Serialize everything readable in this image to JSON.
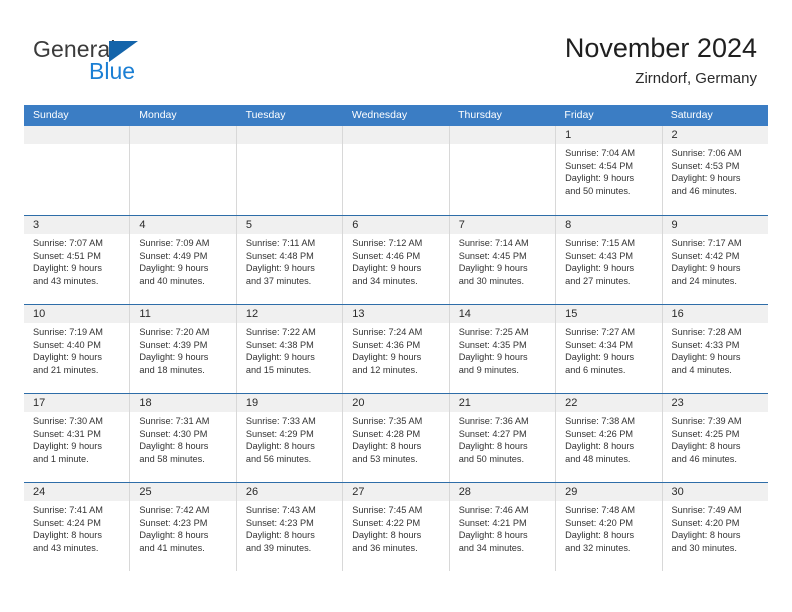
{
  "brand": {
    "line1": "General",
    "line2": "Blue",
    "triangle_color": "#1464aa",
    "line2_color": "#1b7fd4"
  },
  "header": {
    "title": "November 2024",
    "subtitle": "Zirndorf, Germany"
  },
  "theme": {
    "header_row_bg": "#3b7dc4",
    "day_number_bg": "#f0f0f0",
    "row_separator": "#2e6da8",
    "cell_border": "#d8d8d8"
  },
  "weekdays": [
    "Sunday",
    "Monday",
    "Tuesday",
    "Wednesday",
    "Thursday",
    "Friday",
    "Saturday"
  ],
  "weeks": [
    [
      {
        "day": "",
        "empty": true
      },
      {
        "day": "",
        "empty": true
      },
      {
        "day": "",
        "empty": true
      },
      {
        "day": "",
        "empty": true
      },
      {
        "day": "",
        "empty": true
      },
      {
        "day": "1",
        "sunrise": "Sunrise: 7:04 AM",
        "sunset": "Sunset: 4:54 PM",
        "daylight1": "Daylight: 9 hours",
        "daylight2": "and 50 minutes."
      },
      {
        "day": "2",
        "sunrise": "Sunrise: 7:06 AM",
        "sunset": "Sunset: 4:53 PM",
        "daylight1": "Daylight: 9 hours",
        "daylight2": "and 46 minutes."
      }
    ],
    [
      {
        "day": "3",
        "sunrise": "Sunrise: 7:07 AM",
        "sunset": "Sunset: 4:51 PM",
        "daylight1": "Daylight: 9 hours",
        "daylight2": "and 43 minutes."
      },
      {
        "day": "4",
        "sunrise": "Sunrise: 7:09 AM",
        "sunset": "Sunset: 4:49 PM",
        "daylight1": "Daylight: 9 hours",
        "daylight2": "and 40 minutes."
      },
      {
        "day": "5",
        "sunrise": "Sunrise: 7:11 AM",
        "sunset": "Sunset: 4:48 PM",
        "daylight1": "Daylight: 9 hours",
        "daylight2": "and 37 minutes."
      },
      {
        "day": "6",
        "sunrise": "Sunrise: 7:12 AM",
        "sunset": "Sunset: 4:46 PM",
        "daylight1": "Daylight: 9 hours",
        "daylight2": "and 34 minutes."
      },
      {
        "day": "7",
        "sunrise": "Sunrise: 7:14 AM",
        "sunset": "Sunset: 4:45 PM",
        "daylight1": "Daylight: 9 hours",
        "daylight2": "and 30 minutes."
      },
      {
        "day": "8",
        "sunrise": "Sunrise: 7:15 AM",
        "sunset": "Sunset: 4:43 PM",
        "daylight1": "Daylight: 9 hours",
        "daylight2": "and 27 minutes."
      },
      {
        "day": "9",
        "sunrise": "Sunrise: 7:17 AM",
        "sunset": "Sunset: 4:42 PM",
        "daylight1": "Daylight: 9 hours",
        "daylight2": "and 24 minutes."
      }
    ],
    [
      {
        "day": "10",
        "sunrise": "Sunrise: 7:19 AM",
        "sunset": "Sunset: 4:40 PM",
        "daylight1": "Daylight: 9 hours",
        "daylight2": "and 21 minutes."
      },
      {
        "day": "11",
        "sunrise": "Sunrise: 7:20 AM",
        "sunset": "Sunset: 4:39 PM",
        "daylight1": "Daylight: 9 hours",
        "daylight2": "and 18 minutes."
      },
      {
        "day": "12",
        "sunrise": "Sunrise: 7:22 AM",
        "sunset": "Sunset: 4:38 PM",
        "daylight1": "Daylight: 9 hours",
        "daylight2": "and 15 minutes."
      },
      {
        "day": "13",
        "sunrise": "Sunrise: 7:24 AM",
        "sunset": "Sunset: 4:36 PM",
        "daylight1": "Daylight: 9 hours",
        "daylight2": "and 12 minutes."
      },
      {
        "day": "14",
        "sunrise": "Sunrise: 7:25 AM",
        "sunset": "Sunset: 4:35 PM",
        "daylight1": "Daylight: 9 hours",
        "daylight2": "and 9 minutes."
      },
      {
        "day": "15",
        "sunrise": "Sunrise: 7:27 AM",
        "sunset": "Sunset: 4:34 PM",
        "daylight1": "Daylight: 9 hours",
        "daylight2": "and 6 minutes."
      },
      {
        "day": "16",
        "sunrise": "Sunrise: 7:28 AM",
        "sunset": "Sunset: 4:33 PM",
        "daylight1": "Daylight: 9 hours",
        "daylight2": "and 4 minutes."
      }
    ],
    [
      {
        "day": "17",
        "sunrise": "Sunrise: 7:30 AM",
        "sunset": "Sunset: 4:31 PM",
        "daylight1": "Daylight: 9 hours",
        "daylight2": "and 1 minute."
      },
      {
        "day": "18",
        "sunrise": "Sunrise: 7:31 AM",
        "sunset": "Sunset: 4:30 PM",
        "daylight1": "Daylight: 8 hours",
        "daylight2": "and 58 minutes."
      },
      {
        "day": "19",
        "sunrise": "Sunrise: 7:33 AM",
        "sunset": "Sunset: 4:29 PM",
        "daylight1": "Daylight: 8 hours",
        "daylight2": "and 56 minutes."
      },
      {
        "day": "20",
        "sunrise": "Sunrise: 7:35 AM",
        "sunset": "Sunset: 4:28 PM",
        "daylight1": "Daylight: 8 hours",
        "daylight2": "and 53 minutes."
      },
      {
        "day": "21",
        "sunrise": "Sunrise: 7:36 AM",
        "sunset": "Sunset: 4:27 PM",
        "daylight1": "Daylight: 8 hours",
        "daylight2": "and 50 minutes."
      },
      {
        "day": "22",
        "sunrise": "Sunrise: 7:38 AM",
        "sunset": "Sunset: 4:26 PM",
        "daylight1": "Daylight: 8 hours",
        "daylight2": "and 48 minutes."
      },
      {
        "day": "23",
        "sunrise": "Sunrise: 7:39 AM",
        "sunset": "Sunset: 4:25 PM",
        "daylight1": "Daylight: 8 hours",
        "daylight2": "and 46 minutes."
      }
    ],
    [
      {
        "day": "24",
        "sunrise": "Sunrise: 7:41 AM",
        "sunset": "Sunset: 4:24 PM",
        "daylight1": "Daylight: 8 hours",
        "daylight2": "and 43 minutes."
      },
      {
        "day": "25",
        "sunrise": "Sunrise: 7:42 AM",
        "sunset": "Sunset: 4:23 PM",
        "daylight1": "Daylight: 8 hours",
        "daylight2": "and 41 minutes."
      },
      {
        "day": "26",
        "sunrise": "Sunrise: 7:43 AM",
        "sunset": "Sunset: 4:23 PM",
        "daylight1": "Daylight: 8 hours",
        "daylight2": "and 39 minutes."
      },
      {
        "day": "27",
        "sunrise": "Sunrise: 7:45 AM",
        "sunset": "Sunset: 4:22 PM",
        "daylight1": "Daylight: 8 hours",
        "daylight2": "and 36 minutes."
      },
      {
        "day": "28",
        "sunrise": "Sunrise: 7:46 AM",
        "sunset": "Sunset: 4:21 PM",
        "daylight1": "Daylight: 8 hours",
        "daylight2": "and 34 minutes."
      },
      {
        "day": "29",
        "sunrise": "Sunrise: 7:48 AM",
        "sunset": "Sunset: 4:20 PM",
        "daylight1": "Daylight: 8 hours",
        "daylight2": "and 32 minutes."
      },
      {
        "day": "30",
        "sunrise": "Sunrise: 7:49 AM",
        "sunset": "Sunset: 4:20 PM",
        "daylight1": "Daylight: 8 hours",
        "daylight2": "and 30 minutes."
      }
    ]
  ]
}
